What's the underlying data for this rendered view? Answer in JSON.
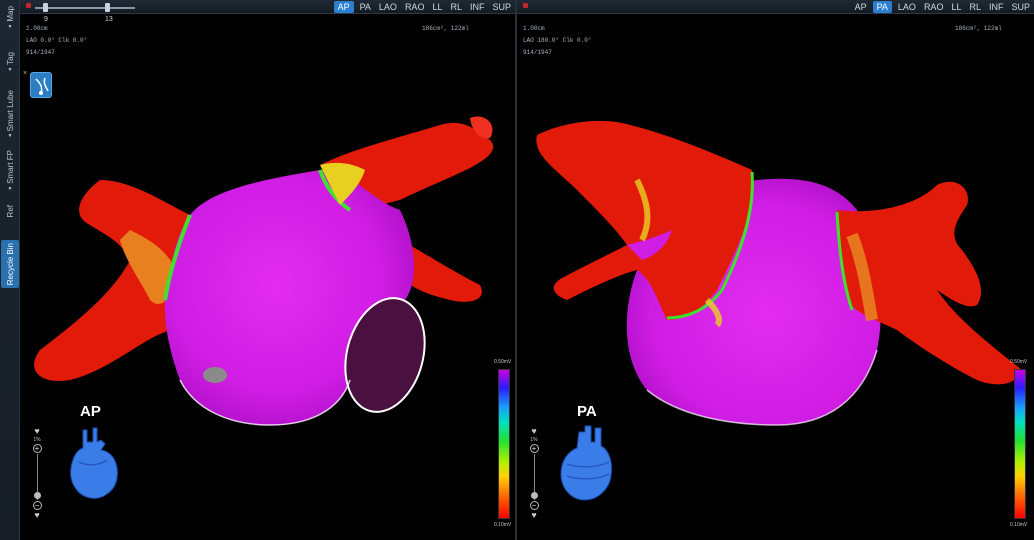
{
  "sidebar": {
    "tabs": [
      {
        "label": "Map",
        "active": false
      },
      {
        "label": "Tag",
        "active": false
      },
      {
        "label": "Smart Lube",
        "active": false
      },
      {
        "label": "Smart FP",
        "active": false
      },
      {
        "label": "Ref",
        "active": false
      },
      {
        "label": "Recycle Bin",
        "active": true
      }
    ]
  },
  "view_buttons": [
    "AP",
    "PA",
    "LAO",
    "RAO",
    "LL",
    "RL",
    "INF",
    "SUP"
  ],
  "left_view": {
    "active_view": "AP",
    "slider_values": [
      "9",
      "13"
    ],
    "overlay_lines": [
      "1.00cm",
      "LAO 0.0° Clk 0.0°",
      "914/1947"
    ],
    "stats": "186cm², 122ml",
    "orientation_label": "AP",
    "zoom_pct": "1%",
    "colorbar_top": "0.50mV",
    "colorbar_bottom": "0.10mV"
  },
  "right_view": {
    "active_view": "PA",
    "overlay_lines": [
      "1.00cm",
      "LAO 180.0° Clk 0.0°",
      "914/1947"
    ],
    "stats": "186cm², 122ml",
    "orientation_label": "PA",
    "zoom_pct": "1%",
    "colorbar_top": "0.50mV",
    "colorbar_bottom": "0.10mV"
  },
  "colors": {
    "accent": "#2a7fd1",
    "scar_red": "#e21a0a",
    "healthy_magenta": "#d21ee6",
    "border_zone_green": "#40e030",
    "heart_icon_blue": "#3a7de8"
  }
}
